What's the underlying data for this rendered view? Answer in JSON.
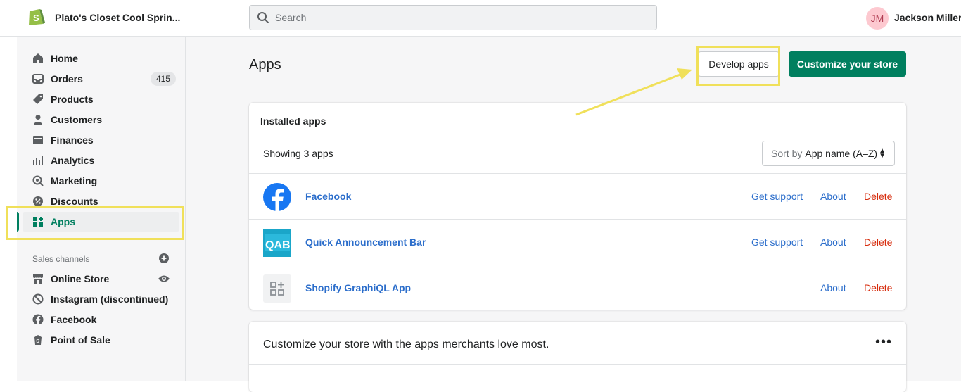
{
  "topbar": {
    "store_name": "Plato's Closet Cool Sprin...",
    "search_placeholder": "Search",
    "user_initials": "JM",
    "user_name": "Jackson Miller"
  },
  "sidebar": {
    "items": [
      {
        "label": "Home",
        "icon": "home-icon"
      },
      {
        "label": "Orders",
        "icon": "orders-icon",
        "badge": "415"
      },
      {
        "label": "Products",
        "icon": "tag-icon"
      },
      {
        "label": "Customers",
        "icon": "person-icon"
      },
      {
        "label": "Finances",
        "icon": "finances-icon"
      },
      {
        "label": "Analytics",
        "icon": "analytics-icon"
      },
      {
        "label": "Marketing",
        "icon": "marketing-icon"
      },
      {
        "label": "Discounts",
        "icon": "discount-icon"
      },
      {
        "label": "Apps",
        "icon": "apps-icon",
        "active": true
      }
    ],
    "sales_channels_label": "Sales channels",
    "channels": [
      {
        "label": "Online Store",
        "icon": "store-icon"
      },
      {
        "label": "Instagram (discontinued)",
        "icon": "blocked-icon"
      },
      {
        "label": "Facebook",
        "icon": "facebook-icon"
      },
      {
        "label": "Point of Sale",
        "icon": "pos-icon"
      }
    ]
  },
  "main": {
    "title": "Apps",
    "develop_apps_label": "Develop apps",
    "customize_label": "Customize your store",
    "installed": {
      "title": "Installed apps",
      "showing": "Showing 3 apps",
      "sort_prefix": "Sort by",
      "sort_value": "App name (A–Z)",
      "apps": [
        {
          "name": "Facebook",
          "support": "Get support",
          "about": "About",
          "delete": "Delete"
        },
        {
          "name": "Quick Announcement Bar",
          "support": "Get support",
          "about": "About",
          "delete": "Delete"
        },
        {
          "name": "Shopify GraphiQL App",
          "about": "About",
          "delete": "Delete"
        }
      ]
    },
    "promo_card": {
      "title": "Customize your store with the apps merchants love most."
    }
  },
  "colors": {
    "accent_green": "#007f5f",
    "link_blue": "#2c6ecb",
    "delete_red": "#d72c0d",
    "highlight_yellow": "#f0e05a"
  }
}
